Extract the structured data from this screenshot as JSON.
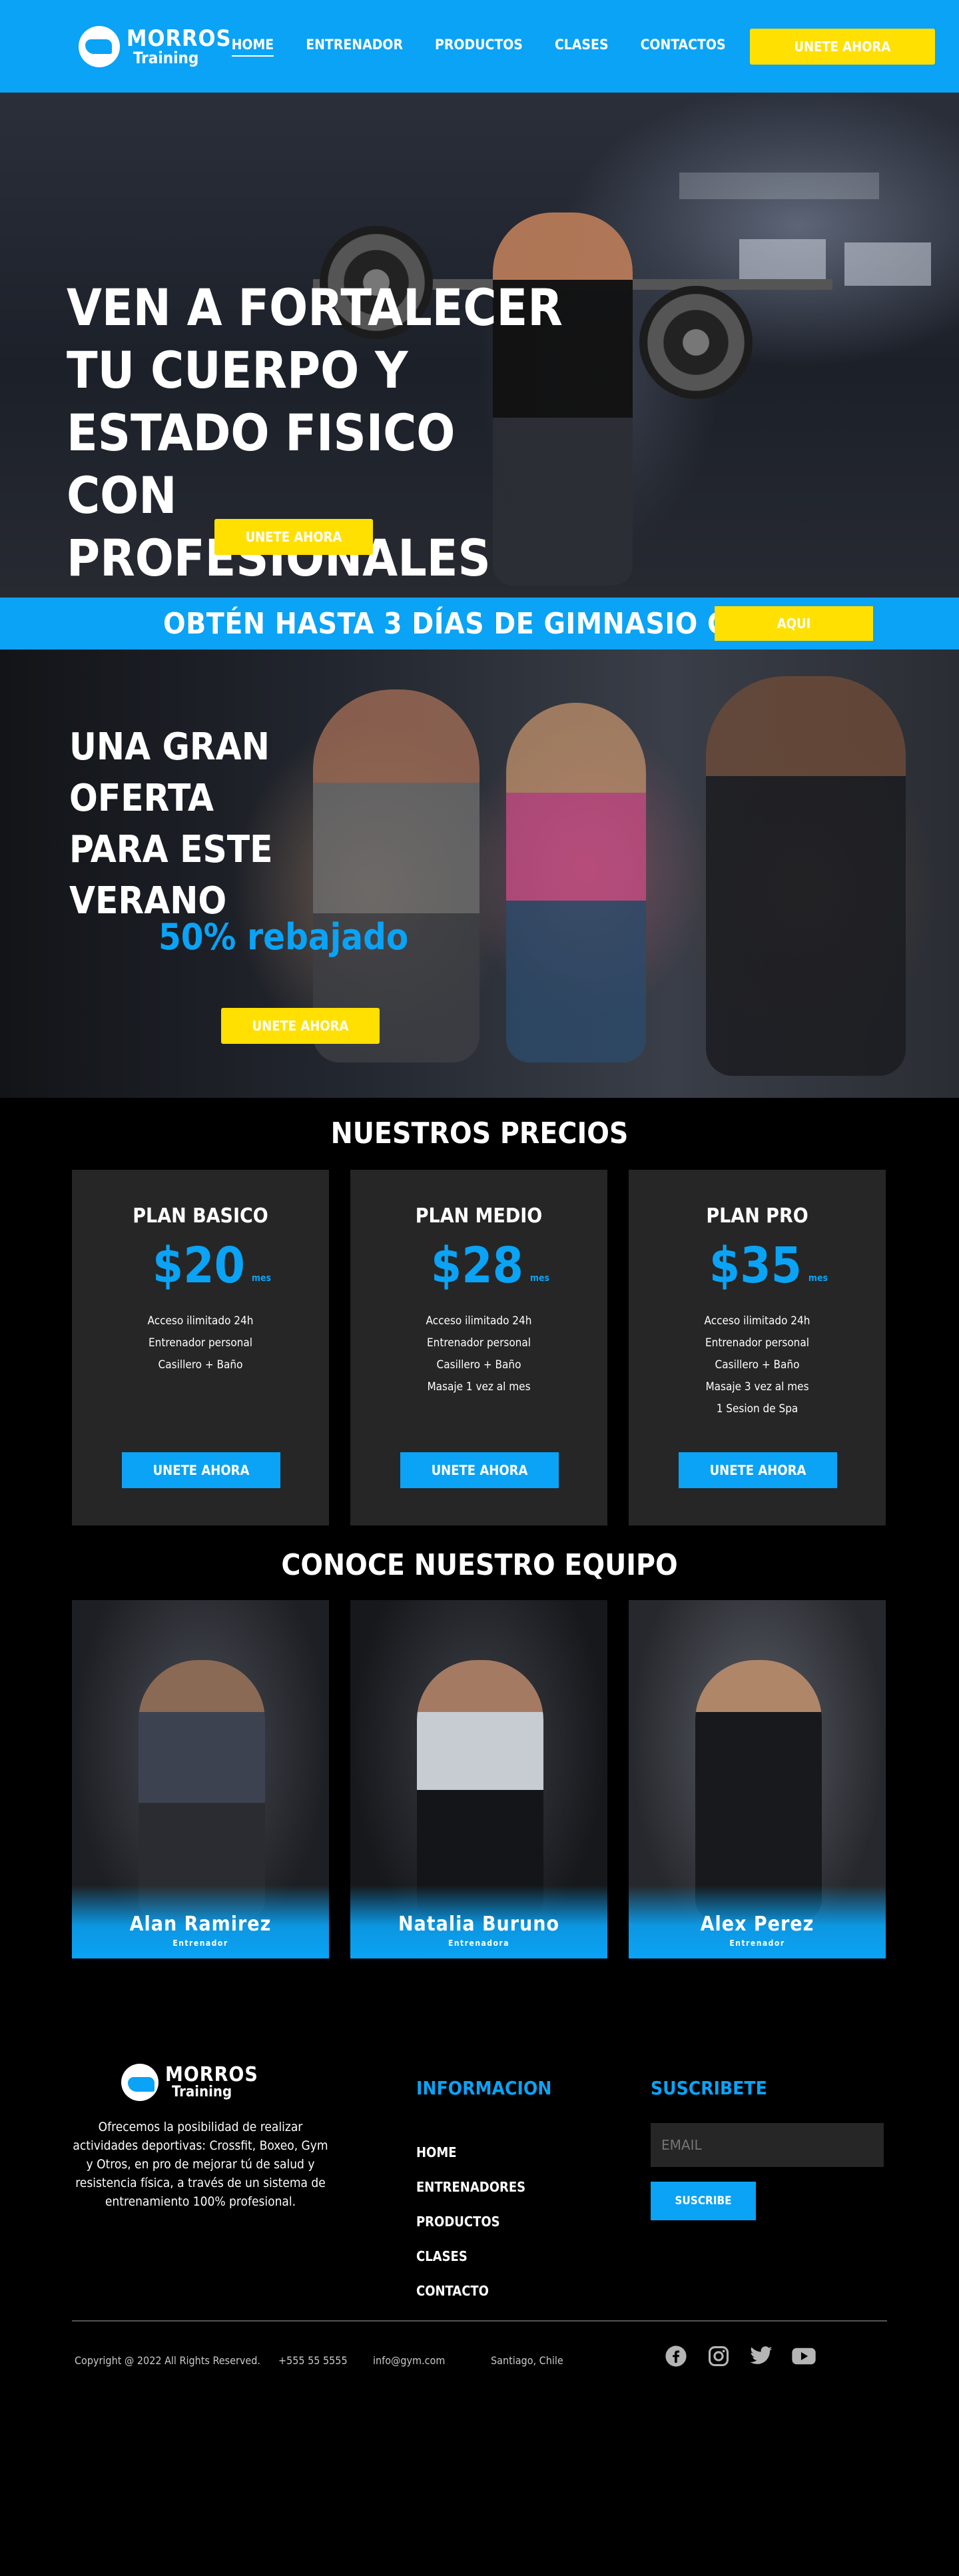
{
  "brand": {
    "name": "MORROS",
    "sub": "Training"
  },
  "nav": {
    "items": [
      {
        "label": "HOME",
        "active": true
      },
      {
        "label": "ENTRENADOR",
        "active": false
      },
      {
        "label": "PRODUCTOS",
        "active": false
      },
      {
        "label": "CLASES",
        "active": false
      },
      {
        "label": "CONTACTOS",
        "active": false
      }
    ],
    "cta": "UNETE AHORA"
  },
  "hero": {
    "title": "VEN A FORTALECER TU CUERPO Y ESTADO FISICO CON PROFESIONALES",
    "cta": "UNETE AHORA"
  },
  "promo": {
    "text": "OBTÉN HASTA 3 DÍAS DE GIMNASIO GRATIS",
    "cta": "AQUI"
  },
  "offer": {
    "title": "UNA GRAN OFERTA PARA ESTE VERANO",
    "discount": "50% rebajado",
    "cta": "UNETE AHORA"
  },
  "prices": {
    "title": "NUESTROS PRECIOS",
    "plans": [
      {
        "name": "PLAN BASICO",
        "price": "$20",
        "period": "mes",
        "features": [
          "Acceso ilimitado 24h",
          "Entrenador personal",
          "Casillero + Baño"
        ],
        "cta": "UNETE AHORA"
      },
      {
        "name": "PLAN MEDIO",
        "price": "$28",
        "period": "mes",
        "features": [
          "Acceso ilimitado 24h",
          "Entrenador personal",
          "Casillero + Baño",
          "Masaje 1 vez al mes"
        ],
        "cta": "UNETE AHORA"
      },
      {
        "name": "PLAN PRO",
        "price": "$35",
        "period": "mes",
        "features": [
          "Acceso ilimitado 24h",
          "Entrenador personal",
          "Casillero + Baño",
          "Masaje 3 vez al mes",
          "1 Sesion de Spa"
        ],
        "cta": "UNETE AHORA"
      }
    ]
  },
  "team": {
    "title": "CONOCE NUESTRO EQUIPO",
    "members": [
      {
        "name": "Alan Ramirez",
        "role": "Entrenador"
      },
      {
        "name": "Natalia Buruno",
        "role": "Entrenadora"
      },
      {
        "name": "Alex Perez",
        "role": "Entrenador"
      }
    ]
  },
  "footer": {
    "description": "Ofrecemos la posibilidad de realizar actividades deportivas: Crossfit, Boxeo, Gym y Otros, en pro de mejorar tú de salud y resistencia física, a través de un sistema de entrenamiento 100% profesional.",
    "info_title": "INFORMACION",
    "links": [
      "HOME",
      "ENTRENADORES",
      "PRODUCTOS",
      "CLASES",
      "CONTACTO"
    ],
    "subscribe_title": "SUSCRIBETE",
    "email_placeholder": "EMAIL",
    "subscribe_cta": "SUSCRIBE",
    "copyright": "Copyright @ 2022 All Rights Reserved.",
    "phone": "+555 55 5555",
    "email": "info@gym.com",
    "location": "Santiago, Chile",
    "socials": [
      "facebook-icon",
      "instagram-icon",
      "twitter-icon",
      "youtube-icon"
    ]
  },
  "colors": {
    "primary": "#0aa3f5",
    "accent": "#ffe000",
    "card": "#262626",
    "background": "#000000"
  }
}
